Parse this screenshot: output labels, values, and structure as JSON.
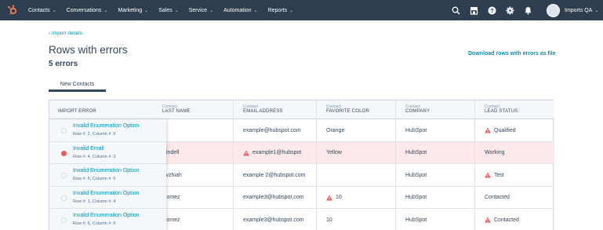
{
  "nav": {
    "items": [
      {
        "label": "Contacts"
      },
      {
        "label": "Conversations"
      },
      {
        "label": "Marketing"
      },
      {
        "label": "Sales"
      },
      {
        "label": "Service"
      },
      {
        "label": "Automation"
      },
      {
        "label": "Reports"
      }
    ],
    "account_name": "Imports QA"
  },
  "header": {
    "back_link": "‹ Import details",
    "title": "Rows with errors",
    "errors_count": "5 errors",
    "download_link": "Download rows with errors as file"
  },
  "tabs": [
    {
      "label": "New Contacts"
    }
  ],
  "table": {
    "columns": [
      {
        "sub": "",
        "label": "IMPORT ERROR"
      },
      {
        "sub": "Contact",
        "label": "LAST NAME"
      },
      {
        "sub": "Contact",
        "label": "EMAIL ADDRESS"
      },
      {
        "sub": "Contact",
        "label": "FAVORITE COLOR"
      },
      {
        "sub": "Contact",
        "label": "COMPANY"
      },
      {
        "sub": "Contact",
        "label": "LEAD STATUS"
      }
    ],
    "rows": [
      {
        "error_title": "Invalid Enumeration Option",
        "error_loc": "Row #: 2, Column #: 6",
        "last_name": "",
        "email": "example@hubspot.com",
        "color": "Orange",
        "company": "HubSpot",
        "status": "Qualified"
      },
      {
        "error_title": "Invalid Email",
        "error_loc": "Row #: 4, Column #: 3",
        "last_name": "windell",
        "email": "example1@hubspot",
        "color": "Yellow",
        "company": "HubSpot",
        "status": "Working"
      },
      {
        "error_title": "Invalid Enumeration Option",
        "error_loc": "Row #: 5, Column #: 6",
        "last_name": "Avzhiah",
        "email": "example 2@hubspot.com",
        "color": "",
        "company": "HubSpot",
        "status": "Test"
      },
      {
        "error_title": "Invalid Enumeration Option",
        "error_loc": "Row #: 1, Column #: 4",
        "last_name": "Gomez",
        "email": "example3@hubspot.com",
        "color": "10",
        "company": "HubSpot",
        "status": "Contacted"
      },
      {
        "error_title": "Invalid Enumeration Option",
        "error_loc": "Row #: 6, Column #: 6",
        "last_name": "Gomez",
        "email": "example3@hubspot.com",
        "color": "10",
        "company": "HubSpot",
        "status": "Contacted"
      }
    ]
  },
  "colors": {
    "nav_bg": "#2d3e50",
    "link": "#0091ae",
    "error_row": "#fde8ea",
    "warning": "#f2545b"
  }
}
